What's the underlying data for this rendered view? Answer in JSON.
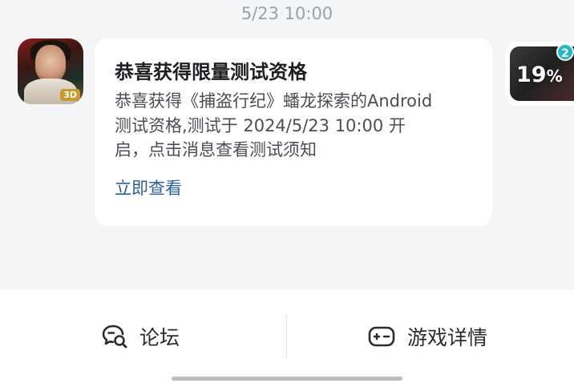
{
  "timestamp": "5/23  10:00",
  "app_icon": {
    "name": "game-app-icon",
    "badge": "3D"
  },
  "message": {
    "title": "恭喜获得限量测试资格",
    "body": "恭喜获得《捕盗行纪》蟠龙探索的Android测试资格,测试于 2024/5/23 10:00 开启，点击消息查看测试须知",
    "link": "立即查看"
  },
  "side_thumb": {
    "percent": "19",
    "percent_sign": "%",
    "count": "2"
  },
  "bottom": {
    "forum_label": "论坛",
    "details_label": "游戏详情"
  },
  "colors": {
    "background": "#f4f5f7",
    "card": "#ffffff",
    "link": "#2b5f9c",
    "badge": "#22b8c7"
  },
  "icons": {
    "forum": "chat-search-icon",
    "details": "gamepad-icon"
  }
}
